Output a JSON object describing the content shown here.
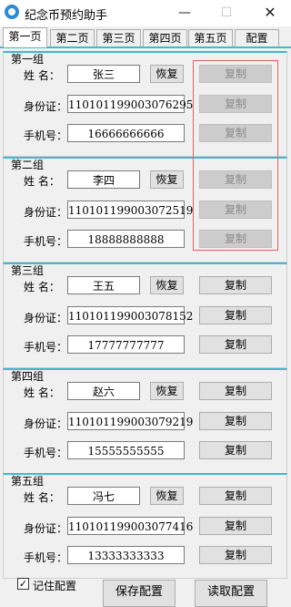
{
  "window": {
    "title": "纪念币预约助手",
    "min_glyph": "—",
    "max_glyph": "☐",
    "close_glyph": "✕"
  },
  "tabs": [
    "第一页",
    "第二页",
    "第三页",
    "第四页",
    "第五页",
    "配置"
  ],
  "labels": {
    "name": "姓  名：",
    "id": "身份证：",
    "phone": "手机号："
  },
  "buttons": {
    "restore": "恢复",
    "copy": "复制"
  },
  "groups": [
    {
      "title": "第一组",
      "name": "张三",
      "id": "110101199003076295",
      "phone": "16666666666"
    },
    {
      "title": "第二组",
      "name": "李四",
      "id": "110101199003072519",
      "phone": "18888888888"
    },
    {
      "title": "第三组",
      "name": "王五",
      "id": "110101199003078152",
      "phone": "17777777777"
    },
    {
      "title": "第四组",
      "name": "赵六",
      "id": "110101199003079219",
      "phone": "15555555555"
    },
    {
      "title": "第五组",
      "name": "冯七",
      "id": "110101199003077416",
      "phone": "13333333333"
    }
  ],
  "footer": {
    "remember_label": "记住配置",
    "remember_checked": true,
    "check_glyph": "✓",
    "save_label": "保存配置",
    "load_label": "读取配置"
  },
  "colors": {
    "tab_accent": "#3dbdd1",
    "highlight_box": "#e06060"
  }
}
